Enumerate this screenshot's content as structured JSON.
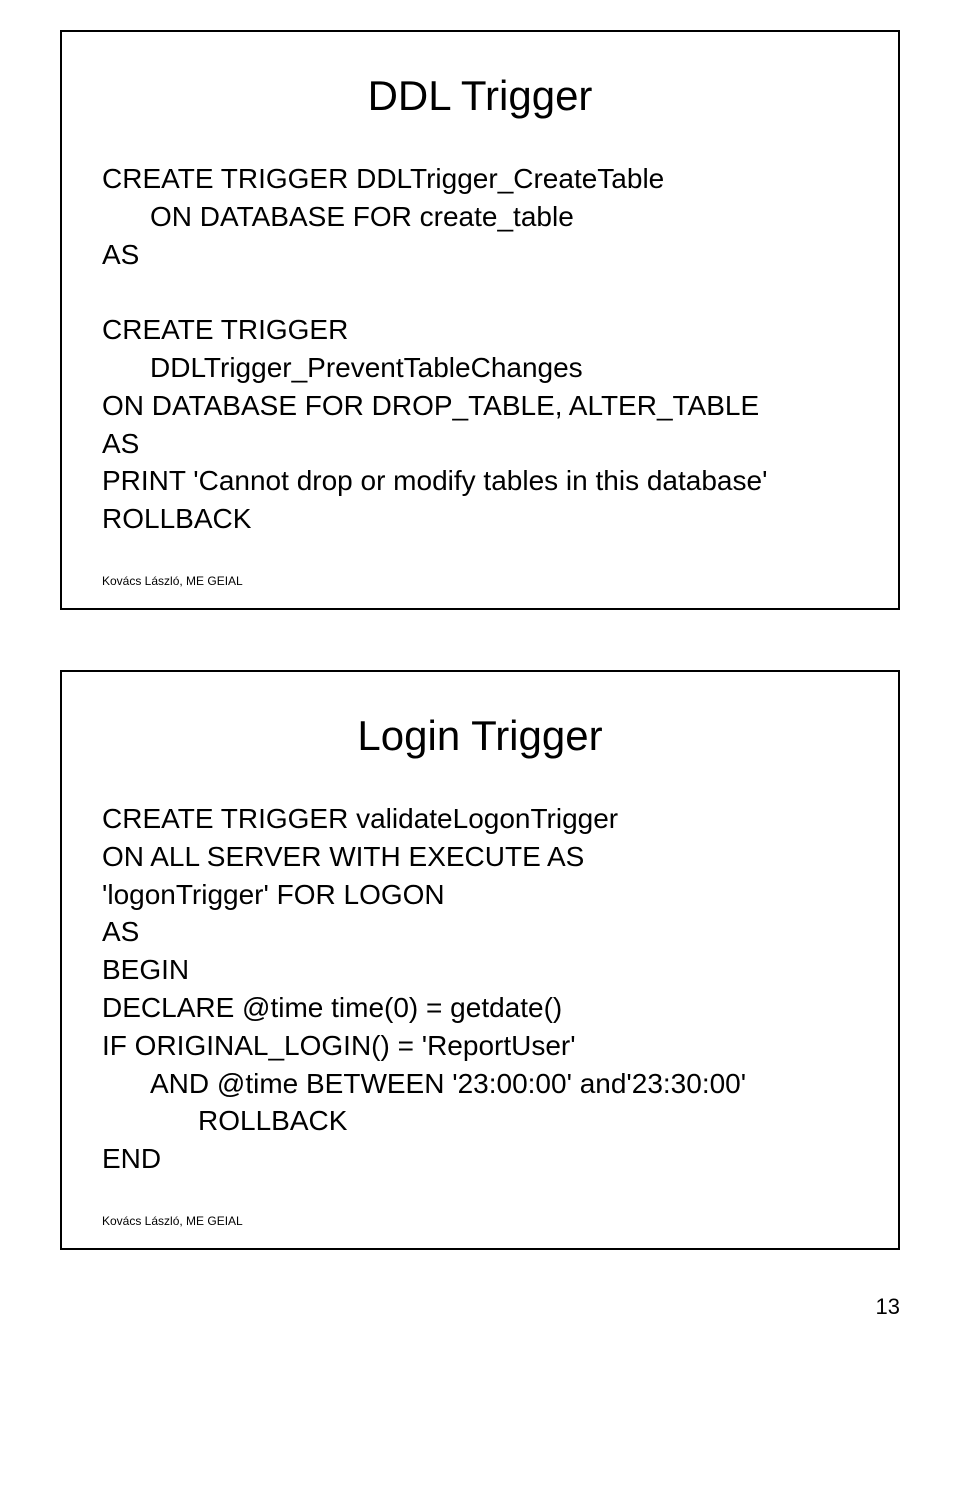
{
  "slide1": {
    "title": "DDL Trigger",
    "lines": [
      {
        "text": "CREATE TRIGGER DDLTrigger_CreateTable",
        "indent": 0
      },
      {
        "text": "ON DATABASE FOR create_table",
        "indent": 1
      },
      {
        "text": "AS",
        "indent": 0
      },
      {
        "text": "",
        "indent": 0
      },
      {
        "text": "CREATE TRIGGER",
        "indent": 0
      },
      {
        "text": "DDLTrigger_PreventTableChanges",
        "indent": 1
      },
      {
        "text": "ON DATABASE FOR DROP_TABLE, ALTER_TABLE",
        "indent": 0
      },
      {
        "text": "AS",
        "indent": 0
      },
      {
        "text": "PRINT 'Cannot drop or modify tables in this database'",
        "indent": 0
      },
      {
        "text": "ROLLBACK",
        "indent": 0
      }
    ],
    "footer": "Kovács László, ME GEIAL"
  },
  "slide2": {
    "title": "Login Trigger",
    "lines": [
      {
        "text": "CREATE TRIGGER validateLogonTrigger",
        "indent": 0
      },
      {
        "text": "ON ALL SERVER WITH EXECUTE AS",
        "indent": 0
      },
      {
        "text": "'logonTrigger' FOR LOGON",
        "indent": 0
      },
      {
        "text": "AS",
        "indent": 0
      },
      {
        "text": "BEGIN",
        "indent": 0
      },
      {
        "text": "DECLARE @time time(0) = getdate()",
        "indent": 0
      },
      {
        "text": "IF ORIGINAL_LOGIN() = 'ReportUser'",
        "indent": 0
      },
      {
        "text": "AND @time BETWEEN '23:00:00' and'23:30:00'",
        "indent": 1
      },
      {
        "text": "ROLLBACK",
        "indent": 2
      },
      {
        "text": "END",
        "indent": 0
      }
    ],
    "footer": "Kovács László, ME GEIAL"
  },
  "pageNumber": "13"
}
